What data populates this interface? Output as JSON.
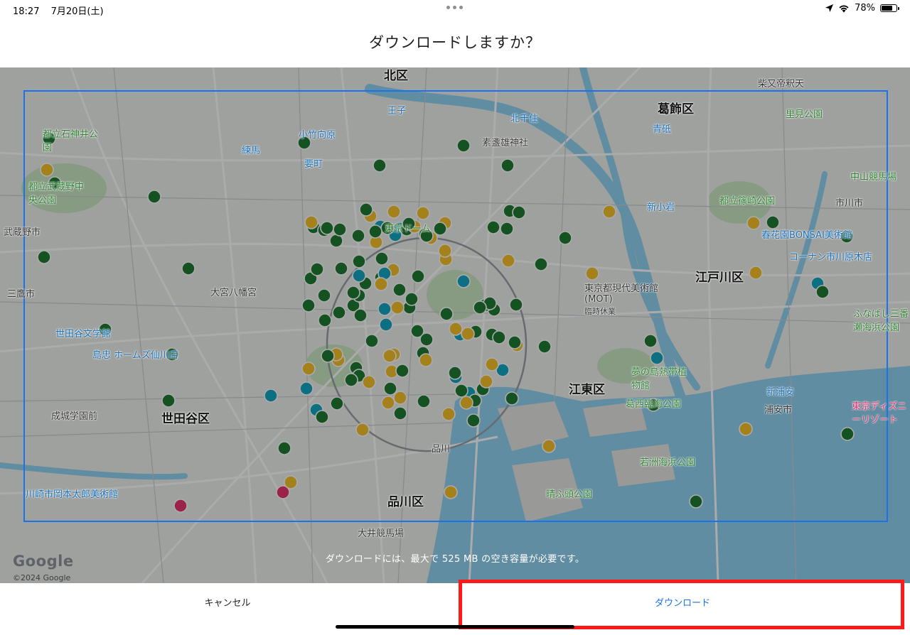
{
  "status_bar": {
    "time": "18:27",
    "date": "7月20日(土)",
    "battery": "78%",
    "battery_level": 0.78,
    "icons": [
      "location-arrow-icon",
      "wifi-icon",
      "battery-icon"
    ]
  },
  "dialog": {
    "title": "ダウンロードしますか？",
    "info": "ダウンロードには、最大で 525 MB の空き容量が必要です。"
  },
  "map": {
    "attribution_logo": "Google",
    "copyright": "©2024 Google",
    "labels": {
      "kita": "北区",
      "katsushika": "葛飾区",
      "edogawa": "江戸川区",
      "koto": "江東区",
      "setagaya": "世田谷区",
      "shinagawa": "品川区",
      "tokyo_dome": "東京ドーム",
      "mot": "東京都現代美術館(MOT)",
      "mot_status": "臨時休業",
      "yume_no_shima": "夢の島熱帯植物館",
      "kasai": "葛西臨海公園",
      "wakasu": "若洲海浜公園",
      "seishun": "晴ふ頭公園",
      "bonsai": "春花園BONSAI美術館",
      "disney": "東京ディズニーリゾート",
      "urayasu": "浦安市",
      "ichikawa": "市川市",
      "musashino": "武蔵野市",
      "mitaka": "三鷹市",
      "kawasaki": "川崎市岡本太郎美術館",
      "setagaya_museum": "世田谷文学館",
      "shimachu": "島忠 ホームズ仙川店",
      "seijo": "成城学園前",
      "omiya": "大宮八幡宮",
      "shinagawa_st": "品川",
      "oi_keiba": "大井競馬場",
      "oji": "王子",
      "kitasenju": "北千住",
      "aoto": "青砥",
      "shinkoiwa": "新小岩",
      "nishiarai": "素盞雄神社",
      "ishigami": "都立石神井公園",
      "musashino_park": "都立武蔵野中央公園",
      "shinozaki": "都立篠崎公園",
      "satomi": "里見公園",
      "shibamata": "柴又帝釈天",
      "konan": "コーナン市川原木店",
      "funabashi": "ふなばし三番瀬海浜公園",
      "shinurayasu": "新浦安",
      "nakayama": "中山競馬場",
      "kodai": "小竹向原",
      "nerima": "練馬",
      "kanamachi": "要町"
    }
  },
  "buttons": {
    "cancel": "キャンセル",
    "download": "ダウンロード"
  },
  "colors": {
    "accent": "#1a73e8",
    "highlight": "#ff1a1a",
    "pin_green": "#1e7b34",
    "pin_yellow": "#f6c02b",
    "pin_teal": "#12a6c2",
    "pin_pink": "#e8336f",
    "water": "#8fd3f0",
    "park": "#c9e7c4"
  }
}
